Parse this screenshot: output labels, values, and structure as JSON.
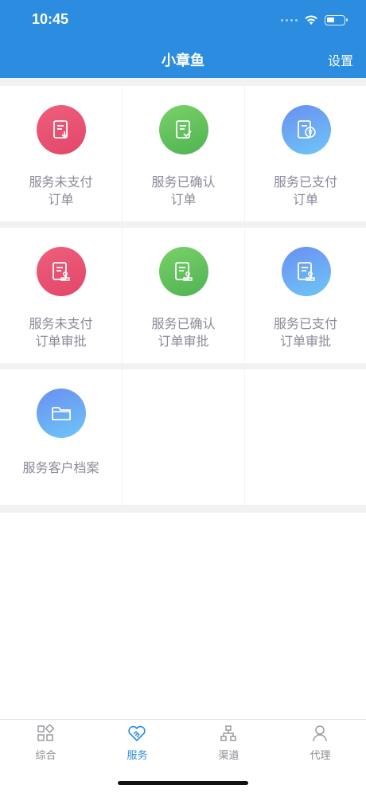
{
  "status_bar": {
    "time": "10:45"
  },
  "nav": {
    "title": "小章鱼",
    "settings_label": "设置"
  },
  "grid": {
    "items": [
      {
        "label": "服务未支付\n订单",
        "color": "#e8506f",
        "icon": "document-download-icon"
      },
      {
        "label": "服务已确认\n订单",
        "color": "#5cbd57",
        "icon": "document-check-icon"
      },
      {
        "label": "服务已支付\n订单",
        "color": "#6aa8f2",
        "icon": "document-yen-icon"
      },
      {
        "label": "服务未支付\n订单审批",
        "color": "#e8506f",
        "icon": "document-stamp-icon"
      },
      {
        "label": "服务已确认\n订单审批",
        "color": "#5cbd57",
        "icon": "document-stamp-icon"
      },
      {
        "label": "服务已支付\n订单审批",
        "color": "#6aa8f2",
        "icon": "document-stamp-icon"
      },
      {
        "label": "服务客户档案",
        "color": "#6aa8f2",
        "icon": "folder-icon"
      }
    ]
  },
  "tabbar": {
    "tabs": [
      {
        "label": "综合",
        "icon": "grid-apps-icon",
        "active": false
      },
      {
        "label": "服务",
        "icon": "handshake-icon",
        "active": true
      },
      {
        "label": "渠道",
        "icon": "network-icon",
        "active": false
      },
      {
        "label": "代理",
        "icon": "person-icon",
        "active": false
      }
    ]
  },
  "colors": {
    "header": "#2c8de0",
    "active_tab": "#2c8de0",
    "label_text": "#8b8a99"
  }
}
